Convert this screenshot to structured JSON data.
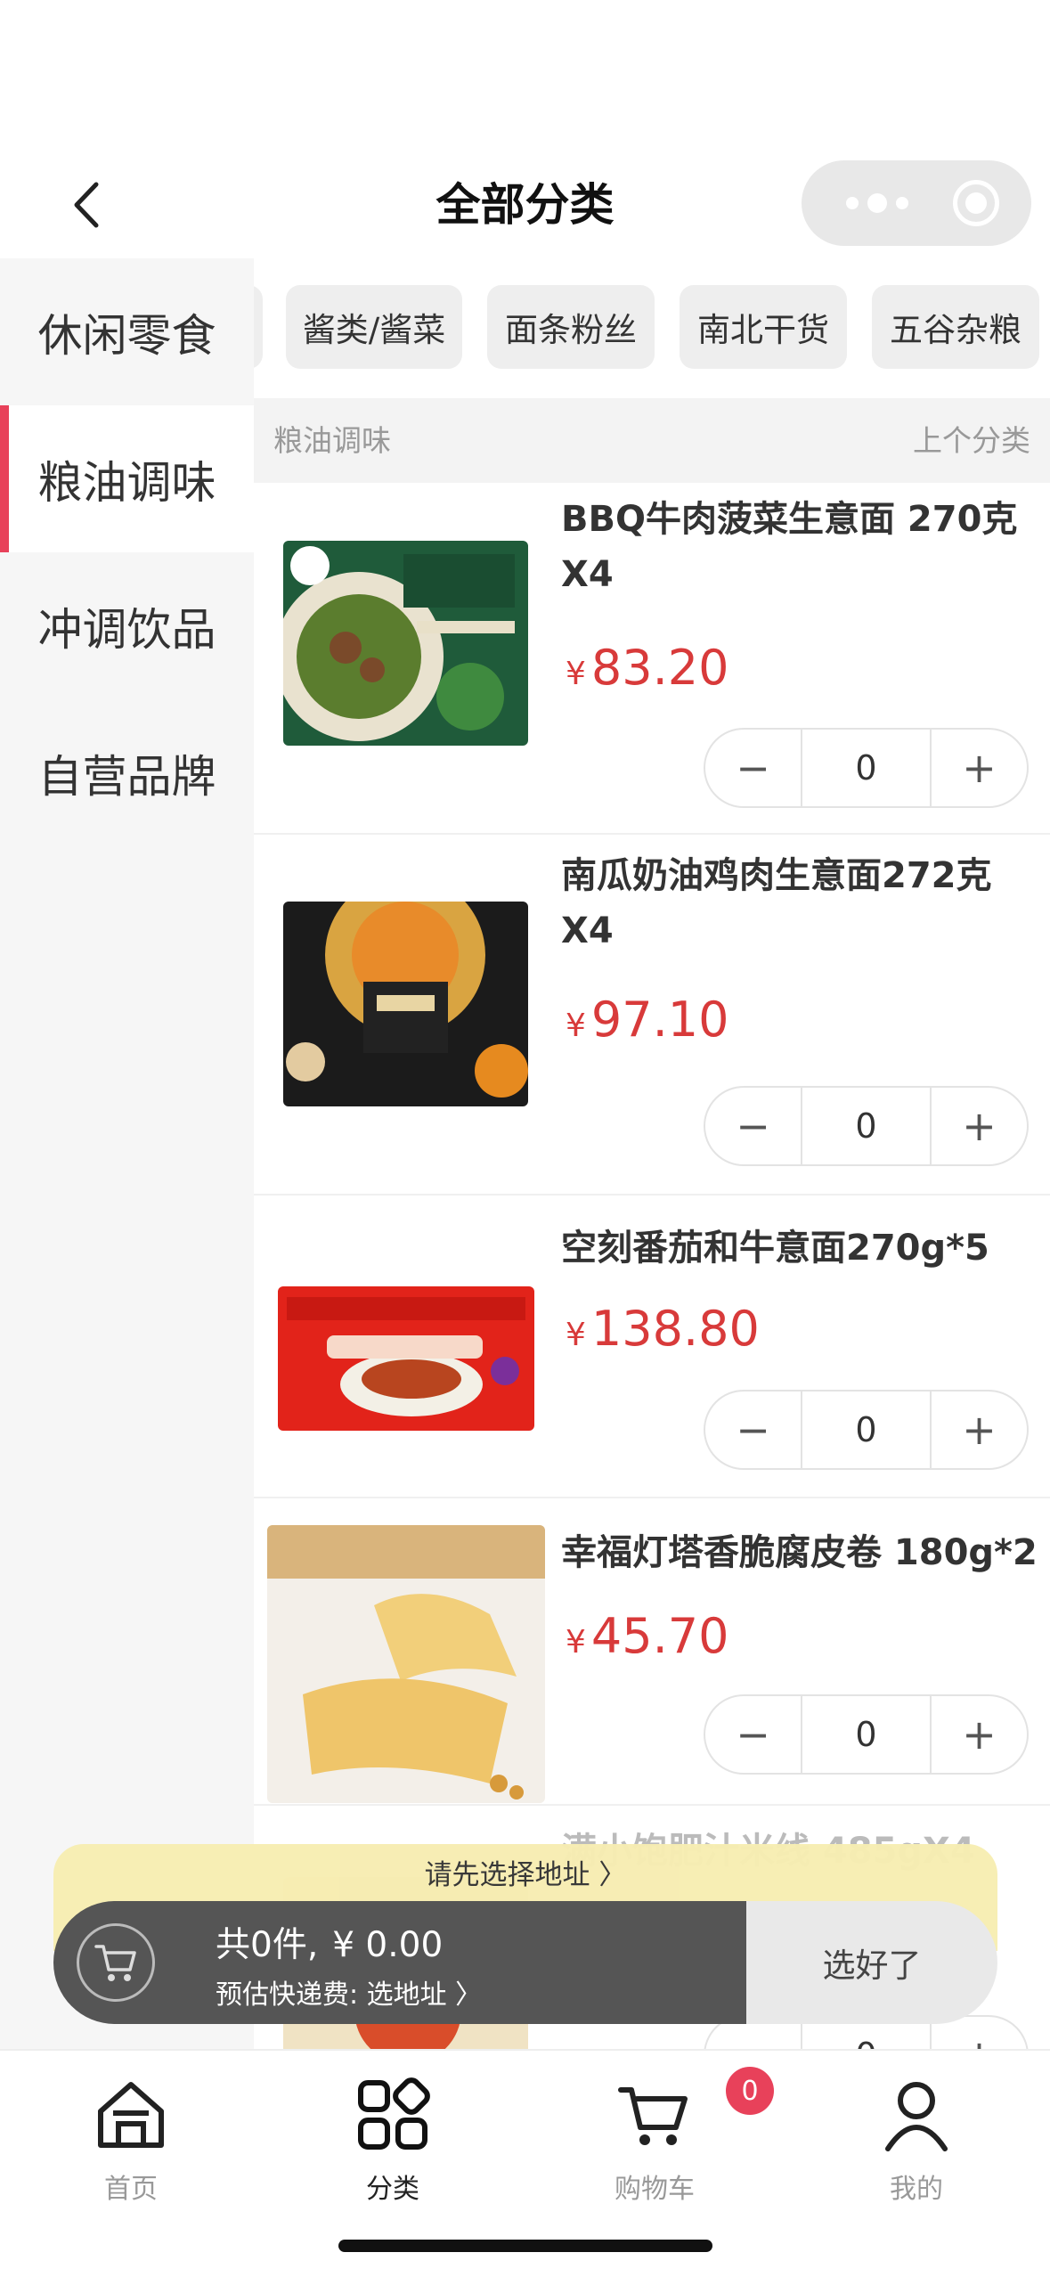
{
  "header": {
    "title": "全部分类"
  },
  "sidebar": {
    "items": [
      {
        "label": "休闲零食",
        "active": false
      },
      {
        "label": "粮油调味",
        "active": true
      },
      {
        "label": "冲调饮品",
        "active": false
      },
      {
        "label": "自营品牌",
        "active": false
      }
    ]
  },
  "chips": [
    "酱类/酱菜",
    "面条粉丝",
    "南北干货",
    "五谷杂粮"
  ],
  "section": {
    "name": "粮油调味",
    "prev_link": "上个分类"
  },
  "products": [
    {
      "name": "BBQ牛肉菠菜生意面 270克X4",
      "currency": "¥",
      "price": "83.20",
      "qty": "0",
      "image": "green-pasta-box"
    },
    {
      "name": "南瓜奶油鸡肉生意面272克X4",
      "currency": "¥",
      "price": "97.10",
      "qty": "0",
      "image": "pumpkin-pasta-box"
    },
    {
      "name": "空刻番茄和牛意面270g*5",
      "currency": "¥",
      "price": "138.80",
      "qty": "0",
      "image": "airmeter-spaghetti-box"
    },
    {
      "name": "幸福灯塔香脆腐皮卷 180g*2",
      "currency": "¥",
      "price": "45.70",
      "qty": "0",
      "image": "tofu-skin-rolls"
    },
    {
      "name": "满小饱肥汁米线 485gX4",
      "currency": "¥",
      "price": "",
      "qty": "0",
      "image": "rice-noodle-pack"
    }
  ],
  "cart": {
    "address_tip": "请先选择地址 〉",
    "count_text": "共0件,",
    "total_text": "¥ 0.00",
    "shipping_text": "预估快递费: 选地址 〉",
    "checkout_label": "选好了"
  },
  "tabbar": {
    "items": [
      {
        "label": "首页",
        "icon": "home-icon",
        "active": false
      },
      {
        "label": "分类",
        "icon": "category-icon",
        "active": true
      },
      {
        "label": "购物车",
        "icon": "cart-icon",
        "active": false
      },
      {
        "label": "我的",
        "icon": "profile-icon",
        "active": false
      }
    ],
    "cart_badge": "0"
  },
  "colors": {
    "accent": "#e8415a",
    "price": "#d83a3a",
    "cart_bar": "#555555",
    "tip_bg": "#f7edb2"
  }
}
